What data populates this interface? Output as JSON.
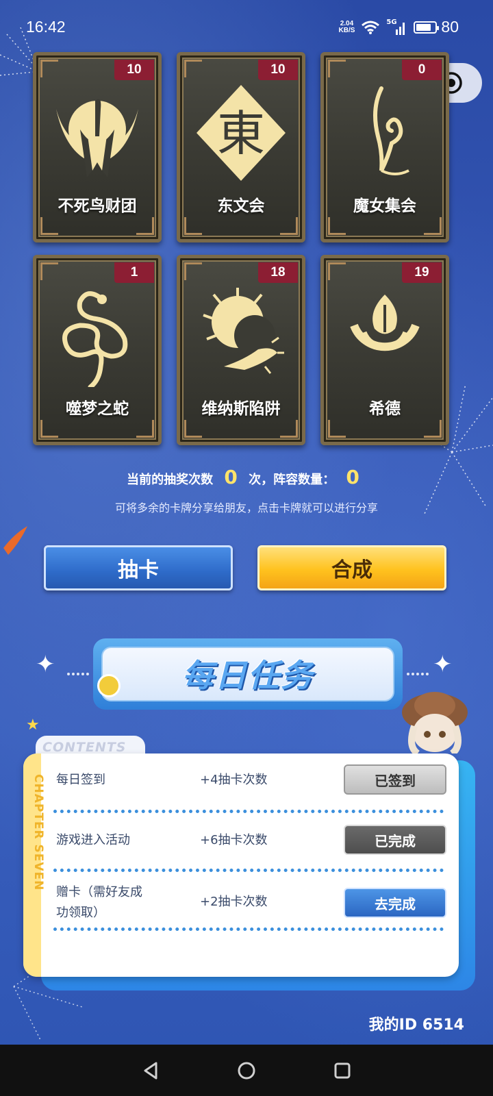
{
  "status_bar": {
    "time": "16:42",
    "net_speed_value": "2.04",
    "net_speed_unit": "KB/S",
    "signal_label": "5G",
    "battery": "80"
  },
  "cards": [
    {
      "name": "不死鸟财团",
      "count": "10",
      "emblem": "phoenix-emblem-icon"
    },
    {
      "name": "东文会",
      "count": "10",
      "emblem": "dong-diamond-emblem-icon"
    },
    {
      "name": "魔女集会",
      "count": "0",
      "emblem": "witch-curl-emblem-icon"
    },
    {
      "name": "噬梦之蛇",
      "count": "1",
      "emblem": "serpent-emblem-icon"
    },
    {
      "name": "维纳斯陷阱",
      "count": "18",
      "emblem": "venus-trap-emblem-icon"
    },
    {
      "name": "希德",
      "count": "19",
      "emblem": "flame-ring-emblem-icon"
    }
  ],
  "dong_glyph": "東",
  "counts": {
    "draw_label": "当前的抽奖次数",
    "draw_value": "0",
    "draw_unit": "次，阵容数量：",
    "lineup_value": "0"
  },
  "share_tip": "可将多余的卡牌分享给朋友，点击卡牌就可以进行分享",
  "buttons": {
    "draw": "抽卡",
    "combine": "合成"
  },
  "daily_tasks": {
    "title": "每日任务",
    "tab_label": "CONTENTS",
    "side_label": "CHAPTER SEVEN",
    "tasks": [
      {
        "name": "每日签到",
        "reward": "+4抽卡次数",
        "action": "已签到"
      },
      {
        "name": "游戏进入活动",
        "reward": "+6抽卡次数",
        "action": "已完成"
      },
      {
        "name": "赠卡（需好友成功领取）",
        "reward": "+2抽卡次数",
        "action": "去完成"
      }
    ]
  },
  "footer": {
    "my_id": "我的ID  6514"
  },
  "colors": {
    "accent_yellow": "#ffe36a",
    "card_badge": "#8c1e33",
    "background_blue": "#2b4fa8"
  }
}
